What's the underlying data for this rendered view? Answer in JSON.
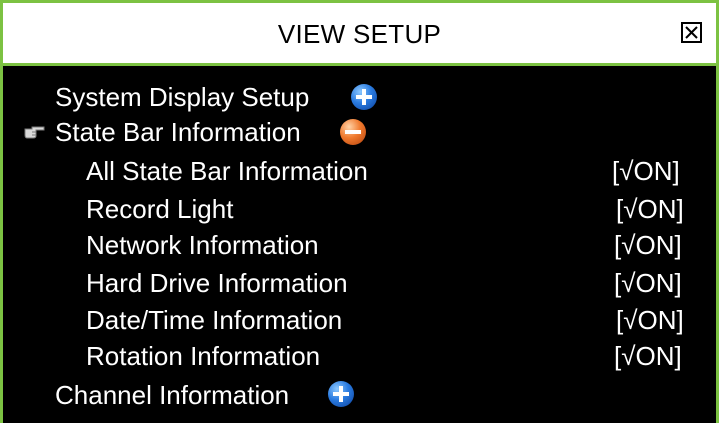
{
  "dialog": {
    "title": "VIEW SETUP",
    "close_icon": "close-box-icon"
  },
  "menu": {
    "system_display_setup": {
      "label": "System Display Setup",
      "icon": "expand-plus-icon"
    },
    "state_bar_information": {
      "label": "State Bar Information",
      "icon": "collapse-minus-icon",
      "pointer_icon": "pointing-hand-icon"
    },
    "items": [
      {
        "label": "All State Bar Information",
        "value": "[√ON]"
      },
      {
        "label": "Record Light",
        "value": "[√ON]"
      },
      {
        "label": "Network Information",
        "value": "[√ON]"
      },
      {
        "label": "Hard Drive Information",
        "value": "[√ON]"
      },
      {
        "label": "Date/Time Information",
        "value": "[√ON]"
      },
      {
        "label": "Rotation Information",
        "value": "[√ON]"
      }
    ],
    "channel_information": {
      "label": "Channel Information",
      "icon": "expand-plus-icon"
    }
  },
  "colors": {
    "accent_border": "#7cc242",
    "background": "#000000",
    "titlebar": "#ffffff",
    "text": "#ffffff"
  }
}
